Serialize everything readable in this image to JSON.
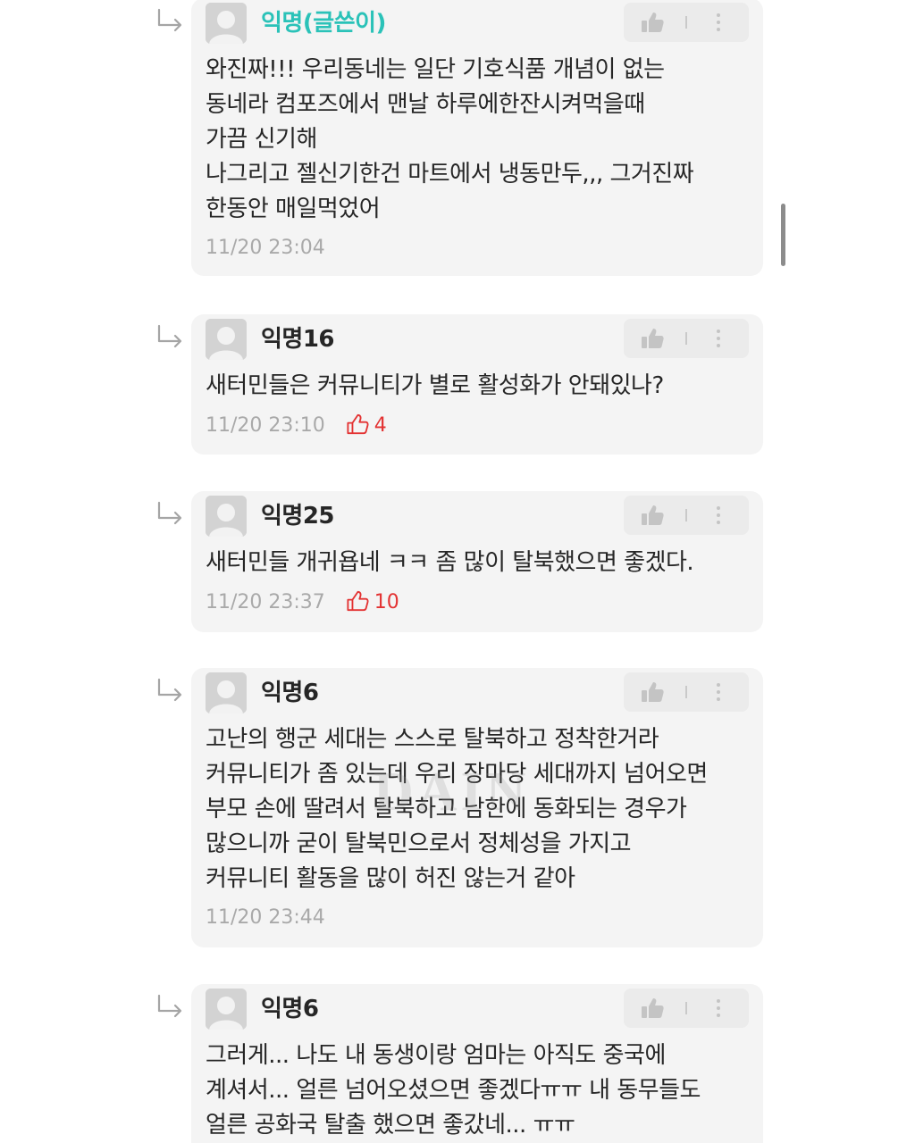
{
  "comments": [
    {
      "author": "익명(글쓴이)",
      "is_author": true,
      "lines": [
        "와진짜!!! 우리동네는 일단 기호식품 개념이 없는",
        "동네라 컴포즈에서 맨날 하루에한잔시켜먹을때",
        "가끔 신기해",
        "나그리고 젤신기한건 마트에서 냉동만두,,, 그거진짜",
        "한동안 매일먹었어"
      ],
      "time": "11/20 23:04",
      "likes": null
    },
    {
      "author": "익명16",
      "is_author": false,
      "lines": [
        "새터민들은 커뮤니티가 별로 활성화가 안돼있나?"
      ],
      "time": "11/20 23:10",
      "likes": "4"
    },
    {
      "author": "익명25",
      "is_author": false,
      "lines": [
        "새터민들 개귀욥네 ㅋㅋ 좀 많이 탈북했으면 좋겠다."
      ],
      "time": "11/20 23:37",
      "likes": "10"
    },
    {
      "author": "익명6",
      "is_author": false,
      "lines": [
        "고난의 행군 세대는 스스로 탈북하고 정착한거라",
        "커뮤니티가 좀 있는데 우리 장마당 세대까지 넘어오면",
        "부모 손에 딸려서 탈북하고 남한에 동화되는 경우가",
        "많으니까 굳이 탈북민으로서 정체성을 가지고",
        "커뮤니티 활동을 많이 허진 않는거 같아"
      ],
      "time": "11/20 23:44",
      "likes": null
    },
    {
      "author": "익명6",
      "is_author": false,
      "lines": [
        "그러게... 나도 내 동생이랑 엄마는 아직도 중국에",
        "계셔서... 얼른 넘어오셨으면 좋겠다ㅠㅠ 내 동무들도",
        "얼른 공화국 탈출 했으면 좋갔네... ㅠㅠ"
      ],
      "time": "",
      "likes": null
    }
  ],
  "watermark": "DAIN",
  "icons": {
    "reply": "reply-arrow-icon",
    "like": "thumbs-up-icon",
    "more": "more-vertical-icon",
    "avatar": "default-avatar-icon"
  },
  "colors": {
    "author_highlight": "#2ac2b8",
    "likes": "#e33232",
    "card_background": "#f4f4f4",
    "timestamp": "#a9a9a9"
  }
}
